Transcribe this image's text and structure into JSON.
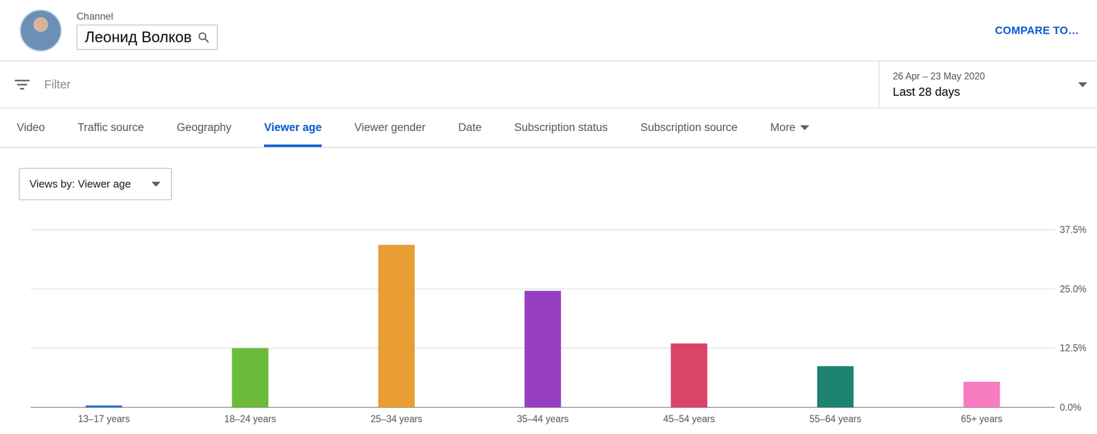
{
  "channel": {
    "label": "Channel",
    "name": "Леонид Волков"
  },
  "compare_button": "COMPARE TO…",
  "filter": {
    "placeholder": "Filter"
  },
  "date_range": {
    "range": "26 Apr – 23 May 2020",
    "label": "Last 28 days"
  },
  "tabs": [
    {
      "label": "Video",
      "selected": false,
      "kind": "tab"
    },
    {
      "label": "Traffic source",
      "selected": false,
      "kind": "tab"
    },
    {
      "label": "Geography",
      "selected": false,
      "kind": "tab"
    },
    {
      "label": "Viewer age",
      "selected": true,
      "kind": "tab"
    },
    {
      "label": "Viewer gender",
      "selected": false,
      "kind": "tab"
    },
    {
      "label": "Date",
      "selected": false,
      "kind": "tab"
    },
    {
      "label": "Subscription status",
      "selected": false,
      "kind": "tab"
    },
    {
      "label": "Subscription source",
      "selected": false,
      "kind": "tab"
    },
    {
      "label": "More",
      "selected": false,
      "kind": "menu"
    }
  ],
  "metric_select": {
    "value": "Views by: Viewer age"
  },
  "chart": {
    "y_ticks": [
      "37.5%",
      "25.0%",
      "12.5%",
      "0.0%"
    ],
    "bars": [
      {
        "label": "13–17 years",
        "value": 0.4,
        "color": "#1565c0"
      },
      {
        "label": "18–24 years",
        "value": 12.5,
        "color": "#5fb52a"
      },
      {
        "label": "25–34 years",
        "value": 34.3,
        "color": "#e69624"
      },
      {
        "label": "35–44 years",
        "value": 24.6,
        "color": "#8e2fbd"
      },
      {
        "label": "45–54 years",
        "value": 13.5,
        "color": "#d6345a"
      },
      {
        "label": "55–64 years",
        "value": 8.7,
        "color": "#0b7766"
      },
      {
        "label": "65+ years",
        "value": 5.4,
        "color": "#f570bb"
      }
    ]
  }
}
